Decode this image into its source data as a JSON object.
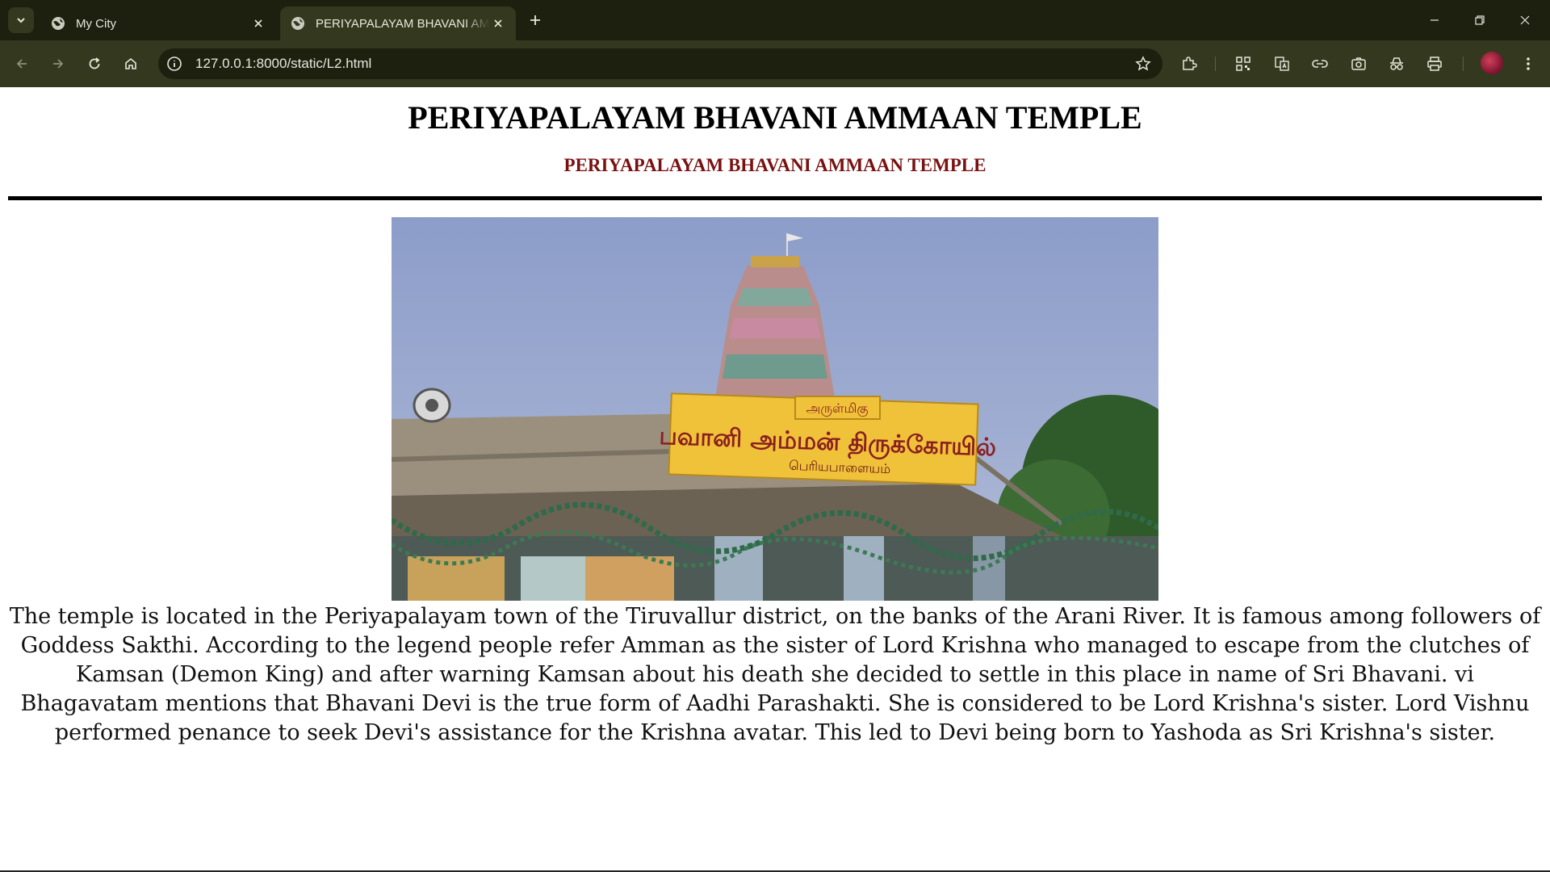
{
  "browser": {
    "tabs": [
      {
        "title": "My City",
        "active": false
      },
      {
        "title": "PERIYAPALAYAM BHAVANI AMMAAN TEMPLE",
        "active": true
      }
    ],
    "url": "127.0.0.1:8000/static/L2.html",
    "colors": {
      "frame": "#1d200f",
      "toolbar": "#34381f",
      "text": "#e6e8da"
    },
    "icons": [
      "tab-search-icon",
      "globe-icon",
      "close-icon",
      "new-tab-icon",
      "minimize-icon",
      "restore-icon",
      "window-close-icon",
      "back-icon",
      "forward-icon",
      "reload-icon",
      "home-icon",
      "site-info-icon",
      "bookmark-star-icon",
      "extensions-icon",
      "qr-code-icon",
      "translate-icon",
      "link-icon",
      "screenshot-icon",
      "incognito-icon",
      "print-icon",
      "profile-avatar",
      "more-menu-icon"
    ]
  },
  "page": {
    "heading": "PERIYAPALAYAM BHAVANI AMMAAN TEMPLE",
    "subheading": "PERIYAPALAYAM BHAVANI AMMAAN TEMPLE",
    "image_signboard": {
      "line1": "அருள்மிகு",
      "line2": "பவானி அம்மன் திருக்கோயில்",
      "line3": "பெரியபாளையம்"
    },
    "paragraph": "The temple is located in the Periyapalayam town of the Tiruvallur district, on the banks of the Arani River. It is famous among followers of Goddess Sakthi. According to the legend people refer Amman as the sister of Lord Krishna who managed to escape from the clutches of Kamsan (Demon King) and after warning Kamsan about his death she decided to settle in this place in name of Sri Bhavani. vi Bhagavatam mentions that Bhavani Devi is the true form of Aadhi Parashakti. She is considered to be Lord Krishna's sister. Lord Vishnu performed penance to seek Devi's assistance for the Krishna avatar. This led to Devi being born to Yashoda as Sri Krishna's sister.",
    "colors": {
      "heading": "#000000",
      "subheading": "#7a1010",
      "rule": "#000000"
    }
  }
}
